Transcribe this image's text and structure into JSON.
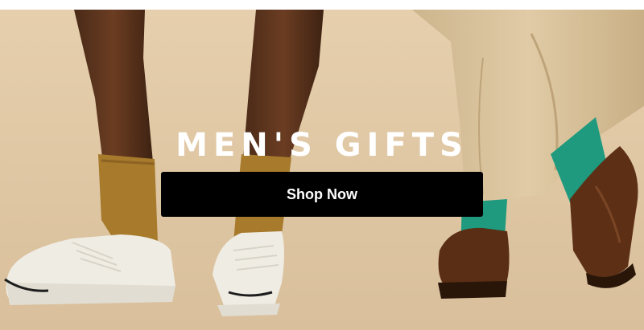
{
  "hero": {
    "headline": "MEN'S GIFTS",
    "cta_label": "Shop Now",
    "background_color": "#dfc6a3",
    "image_description_icon": "feet-sneakers-loafers-image"
  }
}
